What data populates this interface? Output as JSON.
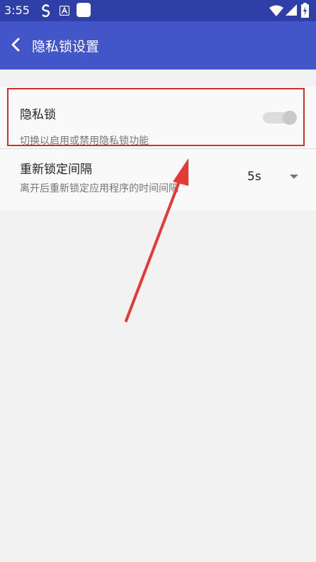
{
  "status_bar": {
    "time": "3:55",
    "icons": [
      "s-logo-icon",
      "a-keyboard-icon",
      "white-square-icon",
      "wifi-icon",
      "signal-icon",
      "battery-charging-icon"
    ]
  },
  "app_bar": {
    "title": "隐私锁设置",
    "back_icon": "chevron-left-icon"
  },
  "settings": {
    "privacy_lock": {
      "title": "隐私锁",
      "summary": "切换以启用或禁用隐私锁功能",
      "enabled": false
    },
    "relock_interval": {
      "title": "重新锁定间隔",
      "summary": "离开后重新锁定应用程序的时间间隔",
      "value": "5s"
    }
  },
  "annotation": {
    "highlight_color": "#d32f2f",
    "arrow_color": "#e53935"
  },
  "colors": {
    "status_bar": "#2f3fa8",
    "app_bar": "#4255c9",
    "background": "#f2f2f2"
  }
}
